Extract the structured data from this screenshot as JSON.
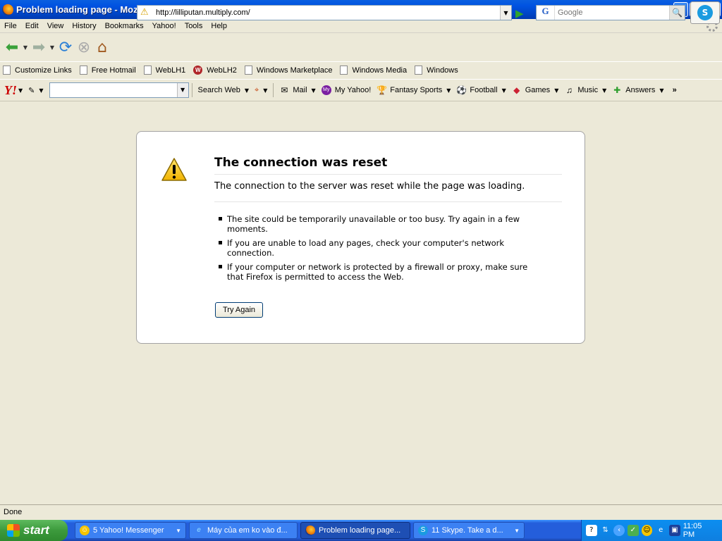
{
  "window": {
    "title": "Problem loading page - Mozilla Firefox"
  },
  "menu": {
    "items": [
      "File",
      "Edit",
      "View",
      "History",
      "Bookmarks",
      "Yahoo!",
      "Tools",
      "Help"
    ]
  },
  "navigation": {
    "url": "http://lilliputan.multiply.com/",
    "search_placeholder": "Google",
    "search_engine": "G"
  },
  "bookmarks": {
    "items": [
      "Customize Links",
      "Free Hotmail",
      "WebLH1",
      "WebLH2",
      "Windows Marketplace",
      "Windows Media",
      "Windows"
    ]
  },
  "yahoo_toolbar": {
    "logo": "Y!",
    "search_web": "Search Web",
    "mail": "Mail",
    "my_yahoo": "My Yahoo!",
    "fantasy_sports": "Fantasy Sports",
    "football": "Football",
    "games": "Games",
    "music": "Music",
    "answers": "Answers",
    "overflow": "»"
  },
  "error_page": {
    "title": "The connection was reset",
    "description": "The connection to the server was reset while the page was loading.",
    "bullets": [
      "The site could be temporarily unavailable or too busy. Try again in a few moments.",
      "If you are unable to load any pages, check your computer's network connection.",
      "If your computer or network is protected by a firewall or proxy, make sure that Firefox is permitted to access the Web."
    ],
    "try_again": "Try Again"
  },
  "status": {
    "text": "Done"
  },
  "taskbar": {
    "start": "start",
    "tasks": [
      "5 Yahoo! Messenger",
      "Máy của em ko vào đ...",
      "Problem loading page...",
      "11 Skype. Take a d..."
    ],
    "clock": "11:05 PM"
  },
  "colors": {
    "titlebar": "#0053e1",
    "chrome": "#ece9d8",
    "taskbar": "#245edb",
    "start": "#3c9a3c"
  }
}
